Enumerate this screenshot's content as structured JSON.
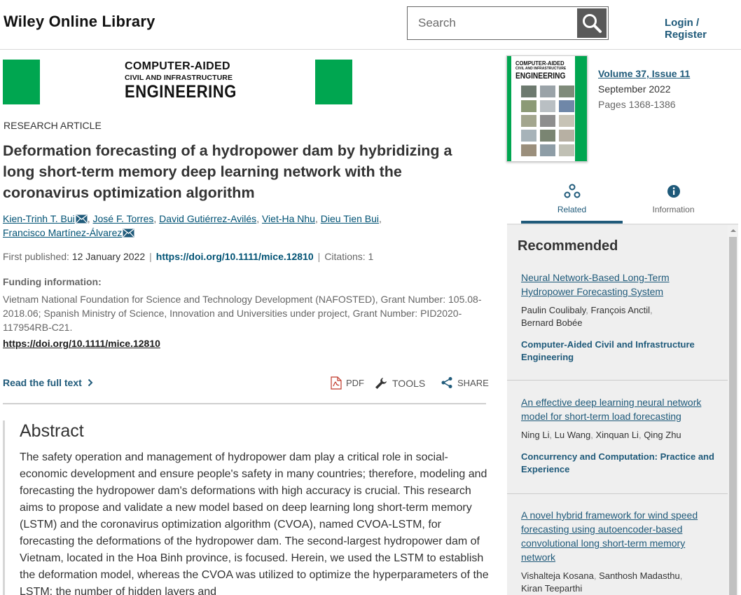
{
  "header": {
    "site_title": "Wiley Online Library",
    "search_placeholder": "Search",
    "login_label": "Login / Register"
  },
  "banner": {
    "journal_line1": "COMPUTER-AIDED",
    "journal_line2": "CIVIL AND INFRASTRUCTURE",
    "journal_line3": "ENGINEERING",
    "brand_color": "#00a650"
  },
  "article": {
    "type": "RESEARCH ARTICLE",
    "title": "Deformation forecasting of a hydropower dam by hybridizing a long short-term memory deep learning network with the coronavirus optimization algorithm",
    "authors": [
      "Kien-Trinh T. Bui",
      "José F. Torres",
      "David Gutiérrez-Avilés",
      "Viet-Ha Nhu",
      "Dieu Tien Bui",
      "Francisco Martínez-Álvarez"
    ],
    "first_published_label": "First published:",
    "first_published_date": "12 January 2022",
    "doi": "https://doi.org/10.1111/mice.12810",
    "citations": "Citations: 1",
    "funding_label": "Funding information:",
    "funding_text": "Vietnam National Foundation for Science and Technology Development (NAFOSTED), Grant Number: 105.08-2018.06; Spanish Ministry of Science, Innovation and Universities under project, Grant Number: PID2020-117954RB-C21.",
    "funding_doi": "https://doi.org/10.1111/mice.12810"
  },
  "actions": {
    "read_full": "Read the full text",
    "pdf": "PDF",
    "tools": "TOOLS",
    "share": "SHARE"
  },
  "abstract": {
    "heading": "Abstract",
    "text": "The safety operation and management of hydropower dam play a critical role in social-economic development and ensure people's safety in many countries; therefore, modeling and forecasting the hydropower dam's deformations with high accuracy is crucial. This research aims to propose and validate a new model based on deep learning long short-term memory (LSTM) and the coronavirus optimization algorithm (CVOA), named CVOA-LSTM, for forecasting the deformations of the hydropower dam. The second-largest hydropower dam of Vietnam, located in the Hoa Binh province, is focused. Herein, we used the LSTM to establish the deformation model, whereas the CVOA was utilized to optimize the hyperparameters of the LSTM: the number of hidden layers and"
  },
  "cover": {
    "title_line1": "COMPUTER-AIDED",
    "title_line2": "CIVIL AND INFRASTRUCTURE",
    "title_line3": "ENGINEERING"
  },
  "issue": {
    "volume": "Volume",
    "volume_num": "37,",
    "issue": "Issue",
    "issue_num": "11",
    "date": "September 2022",
    "pages": "Pages 1368-1386"
  },
  "tabs": {
    "related": "Related",
    "information": "Information"
  },
  "recommended": {
    "heading": "Recommended",
    "items": [
      {
        "title": "Neural Network-Based Long-Term Hydropower Forecasting System",
        "authors": [
          "Paulin Coulibaly",
          "François Anctil",
          "Bernard Bobée"
        ],
        "journal": "Computer-Aided Civil and Infrastructure Engineering"
      },
      {
        "title": "An effective deep learning neural network model for short-term load forecasting",
        "authors": [
          "Ning Li",
          "Lu Wang",
          "Xinquan Li",
          "Qing Zhu"
        ],
        "journal": "Concurrency and Computation: Practice and Experience"
      },
      {
        "title": "A novel hybrid framework for wind speed forecasting using autoencoder-based convolutional long short-term memory network",
        "authors": [
          "Vishalteja Kosana",
          "Santhosh Madasthu",
          "Kiran Teeparthi"
        ],
        "journal": ""
      }
    ]
  }
}
